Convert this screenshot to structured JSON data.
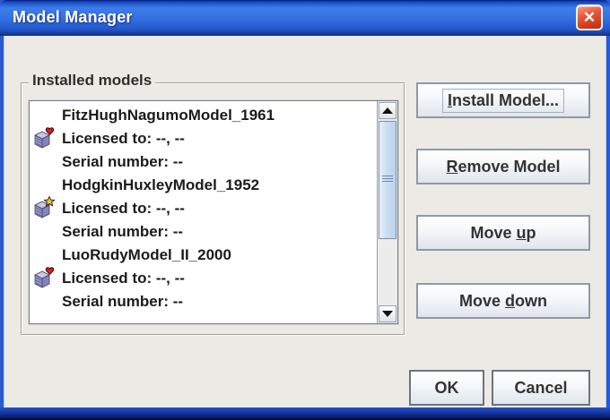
{
  "window": {
    "title": "Model Manager",
    "close_glyph": "✕"
  },
  "group": {
    "title": "Installed models"
  },
  "models": [
    {
      "name": "FitzHughNagumoModel_1961",
      "licensed": "Licensed to: --, --",
      "serial": "Serial number: --",
      "icon": "package-heart-icon"
    },
    {
      "name": "HodgkinHuxleyModel_1952",
      "licensed": "Licensed to: --, --",
      "serial": "Serial number: --",
      "icon": "package-star-icon"
    },
    {
      "name": "LuoRudyModel_II_2000",
      "licensed": "Licensed to: --, --",
      "serial": "Serial number: --",
      "icon": "package-heart-icon"
    }
  ],
  "buttons": {
    "install": {
      "label": "Install Model...",
      "mnemonic": 0
    },
    "remove": {
      "label": "Remove Model",
      "mnemonic": 0
    },
    "move_up": {
      "label": "Move up",
      "mnemonic": 5
    },
    "move_down": {
      "label": "Move down",
      "mnemonic": 5
    },
    "ok": {
      "label": "OK",
      "mnemonic": -1
    },
    "cancel": {
      "label": "Cancel",
      "mnemonic": -1
    }
  },
  "colors": {
    "titlebar_blue": "#3671e4",
    "border_blue": "#2b59d2",
    "close_red": "#cf3c1c",
    "content_gray": "#eceae4",
    "scroll_thumb_blue": "#cbdef2"
  }
}
